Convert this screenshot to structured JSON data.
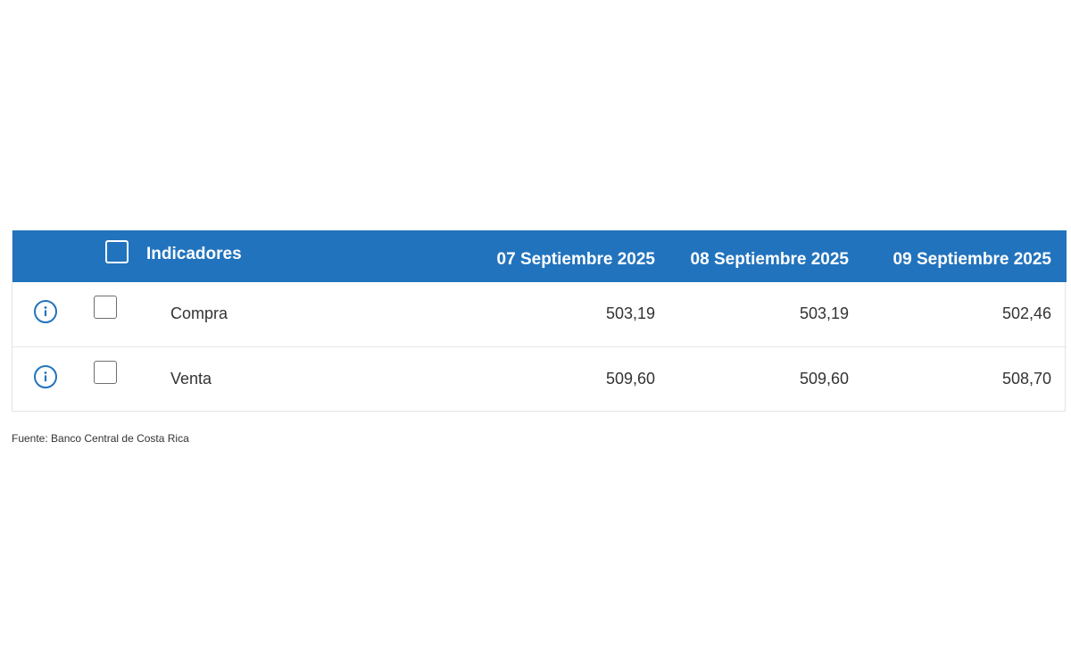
{
  "table": {
    "header": {
      "indicators_label": "Indicadores",
      "dates": [
        "07 Septiembre 2025",
        "08 Septiembre 2025",
        "09 Septiembre 2025"
      ]
    },
    "rows": [
      {
        "name": "Compra",
        "values": [
          "503,19",
          "503,19",
          "502,46"
        ],
        "info_icon": "info-circle-icon"
      },
      {
        "name": "Venta",
        "values": [
          "509,60",
          "509,60",
          "508,70"
        ],
        "info_icon": "info-circle-icon"
      }
    ],
    "accent_color": "#2273bd"
  },
  "footer": {
    "source": "Fuente: Banco Central de Costa Rica"
  }
}
